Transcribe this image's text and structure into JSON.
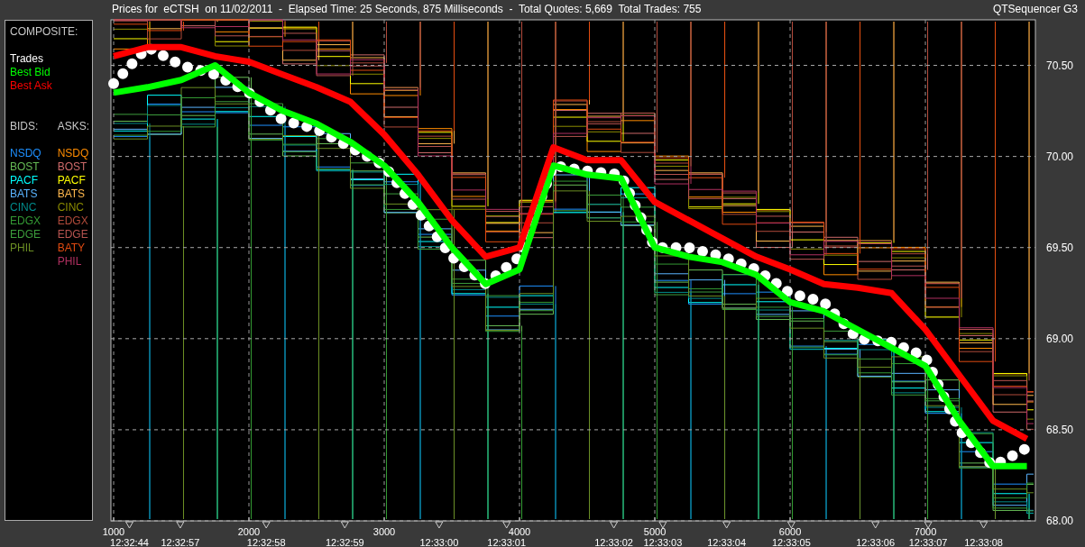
{
  "header": {
    "title": "Prices for  eCTSH  on 11/02/2011  -  Elapsed Time: 25 Seconds, 875 Milliseconds  -  Total Quotes: 5,669  Total Trades: 755",
    "app_name": "QTSequencer G3"
  },
  "legend": {
    "composite_heading": "COMPOSITE:",
    "bids_heading": "BIDS:",
    "asks_heading": "ASKS:",
    "bids": [
      {
        "label": "NSDQ",
        "color": "#1e90ff"
      },
      {
        "label": "BOST",
        "color": "#66bb55"
      },
      {
        "label": "PACF",
        "color": "#00ffff"
      },
      {
        "label": "BATS",
        "color": "#5ab4ff"
      },
      {
        "label": "CINC",
        "color": "#008b8b"
      },
      {
        "label": "EDGX",
        "color": "#339933"
      },
      {
        "label": "EDGE",
        "color": "#3c9d3c"
      },
      {
        "label": "PHIL",
        "color": "#6b8e23"
      }
    ],
    "asks": [
      {
        "label": "NSDQ",
        "color": "#ff8c00"
      },
      {
        "label": "BOST",
        "color": "#cd6a6a"
      },
      {
        "label": "PACF",
        "color": "#ffff00"
      },
      {
        "label": "BATS",
        "color": "#ffb84d"
      },
      {
        "label": "CINC",
        "color": "#8b8b00"
      },
      {
        "label": "EDGX",
        "color": "#b04a3a"
      },
      {
        "label": "EDGE",
        "color": "#b85450"
      },
      {
        "label": "BATY",
        "color": "#e04a10"
      },
      {
        "label": "PHIL",
        "color": "#b03060"
      }
    ]
  },
  "plot": {
    "chart_data": {
      "type": "line",
      "grid": true,
      "x": [
        1000,
        1250,
        1500,
        1750,
        2000,
        2250,
        2500,
        2750,
        3000,
        3250,
        3500,
        3750,
        4000,
        4250,
        4500,
        4750,
        5000,
        5250,
        5500,
        5750,
        6000,
        6250,
        6500,
        6750,
        7000,
        7250,
        7500,
        7750
      ],
      "series": [
        {
          "name": "Trades",
          "color": "#ffffff",
          "line_style": "dotted",
          "values": [
            70.4,
            70.6,
            70.5,
            70.45,
            70.35,
            70.2,
            70.15,
            70.05,
            69.95,
            69.7,
            69.45,
            69.3,
            69.45,
            69.95,
            69.92,
            69.9,
            69.5,
            69.5,
            69.45,
            69.38,
            69.25,
            69.2,
            69.0,
            68.98,
            68.9,
            68.5,
            68.3,
            68.4
          ]
        },
        {
          "name": "Best Bid",
          "color": "#00ff00",
          "line_style": "solid",
          "values": [
            70.35,
            70.38,
            70.42,
            70.5,
            70.35,
            70.25,
            70.18,
            70.08,
            69.95,
            69.75,
            69.5,
            69.3,
            69.38,
            69.95,
            69.9,
            69.88,
            69.5,
            69.45,
            69.42,
            69.35,
            69.2,
            69.15,
            69.05,
            68.95,
            68.85,
            68.55,
            68.3,
            68.3
          ]
        },
        {
          "name": "Best Ask",
          "color": "#ff0000",
          "line_style": "solid",
          "values": [
            70.55,
            70.6,
            70.6,
            70.55,
            70.52,
            70.45,
            70.38,
            70.3,
            70.12,
            69.9,
            69.65,
            69.45,
            69.5,
            70.05,
            69.98,
            69.98,
            69.75,
            69.65,
            69.55,
            69.45,
            69.38,
            69.3,
            69.28,
            69.25,
            69.05,
            68.8,
            68.55,
            68.45
          ]
        }
      ],
      "xlim": [
        980,
        7813
      ],
      "ylim": [
        68.0,
        70.75
      ],
      "xticks": [
        {
          "value": 1000,
          "label": "1000"
        },
        {
          "value": 2000,
          "label": "2000"
        },
        {
          "value": 3000,
          "label": "3000"
        },
        {
          "value": 4000,
          "label": "4000"
        },
        {
          "value": 5000,
          "label": "5000"
        },
        {
          "value": 6000,
          "label": "6000"
        },
        {
          "value": 7000,
          "label": "7000"
        }
      ],
      "yticks": [
        {
          "value": 70.5,
          "label": "70.50"
        },
        {
          "value": 70.0,
          "label": "70.00"
        },
        {
          "value": 69.5,
          "label": "69.50"
        },
        {
          "value": 69.0,
          "label": "69.00"
        },
        {
          "value": 68.5,
          "label": "68.50"
        },
        {
          "value": 68.0,
          "label": "68.00"
        }
      ],
      "annotations": [
        "12:32:44",
        "12:32:57",
        "12:32:58",
        "12:32:59",
        "12:33:00",
        "12:33:01",
        "12:33:02",
        "12:33:03",
        "12:33:04",
        "12:33:05",
        "12:33:06",
        "12:33:07",
        "12:33:08"
      ]
    }
  }
}
